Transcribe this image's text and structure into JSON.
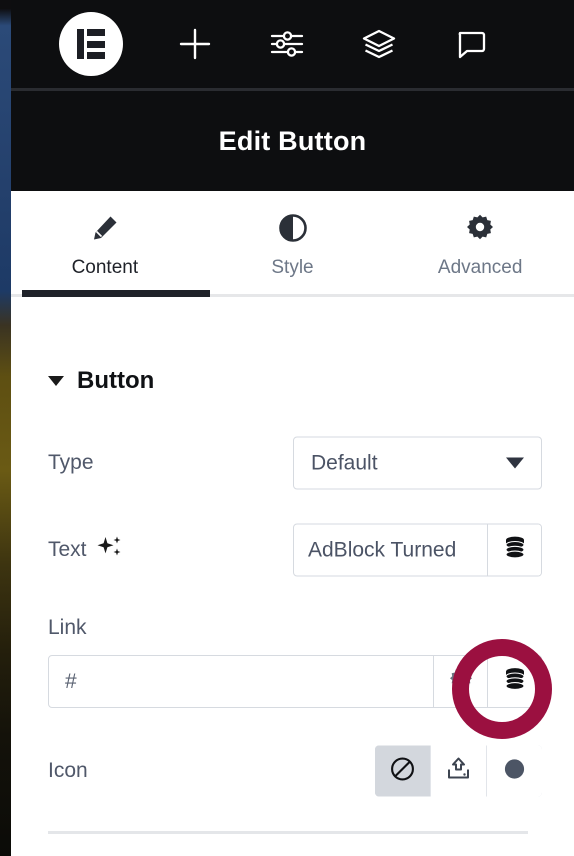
{
  "toolbar": {
    "logo": "elementor-logo",
    "items": [
      {
        "name": "add-element-button",
        "icon": "plus-icon"
      },
      {
        "name": "site-settings-button",
        "icon": "sliders-icon"
      },
      {
        "name": "navigator-button",
        "icon": "layers-icon"
      },
      {
        "name": "comments-button",
        "icon": "comment-icon"
      }
    ]
  },
  "header": {
    "title": "Edit Button"
  },
  "tabs": [
    {
      "label": "Content",
      "icon": "pencil-icon",
      "active": true
    },
    {
      "label": "Style",
      "icon": "contrast-icon",
      "active": false
    },
    {
      "label": "Advanced",
      "icon": "gear-icon",
      "active": false
    }
  ],
  "section": {
    "title": "Button",
    "expanded": true
  },
  "fields": {
    "type": {
      "label": "Type",
      "value": "Default",
      "control": "select"
    },
    "text": {
      "label": "Text",
      "ai_icon": "sparkle-icon",
      "value": "AdBlock Turned",
      "dynamic_icon": "database-icon"
    },
    "link": {
      "label": "Link",
      "value": "#",
      "options_icon": "gear-icon",
      "dynamic_icon": "database-icon"
    },
    "icon": {
      "label": "Icon",
      "choices": [
        {
          "name": "icon-none",
          "icon": "circle-slash-icon",
          "selected": true
        },
        {
          "name": "icon-upload-svg",
          "icon": "upload-icon",
          "selected": false
        },
        {
          "name": "icon-library",
          "icon": "filled-circle-icon",
          "selected": false
        }
      ]
    }
  },
  "annotation": {
    "target": "link-dynamic-tags-button",
    "shape": "circle-highlight",
    "color": "#9b1040"
  },
  "colors": {
    "panel_dark": "#0d0e10",
    "text_muted": "#50586a",
    "border": "#d6dae0",
    "active_tab": "#1f2229",
    "highlight": "#9b1040"
  }
}
